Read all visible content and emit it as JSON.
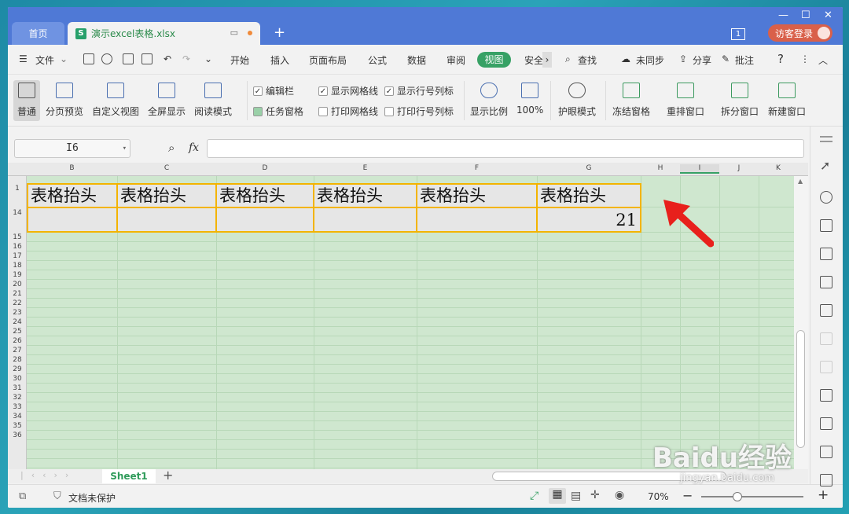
{
  "tabs": {
    "home": "首页",
    "doc": "演示excel表格.xlsx"
  },
  "window": {
    "badge": "1",
    "login": "访客登录"
  },
  "menu": {
    "file": "文件",
    "items": [
      "开始",
      "插入",
      "页面布局",
      "公式",
      "数据",
      "审阅",
      "视图",
      "安全"
    ],
    "find": "查找",
    "sync": "未同步",
    "share": "分享",
    "comment": "批注",
    "help": "?"
  },
  "ribbon": {
    "normal": "普通",
    "pagebreak": "分页预览",
    "customview": "自定义视图",
    "fullscreen": "全屏显示",
    "reading": "阅读模式",
    "editbar": "编辑栏",
    "taskpane": "任务窗格",
    "showgrid": "显示网格线",
    "printgrid": "打印网格线",
    "showhead": "显示行号列标",
    "printhead": "打印行号列标",
    "zoom": "显示比例",
    "zoom100": "100%",
    "eyecare": "护眼模式",
    "freeze": "冻结窗格",
    "arrange": "重排窗口",
    "split": "拆分窗口",
    "newwin": "新建窗口"
  },
  "formula": {
    "name_box": "I6",
    "fx": "fx",
    "value": ""
  },
  "columns": [
    "B",
    "C",
    "D",
    "E",
    "F",
    "G",
    "H",
    "I",
    "J",
    "K"
  ],
  "rows": [
    "1",
    "14",
    "15",
    "16",
    "17",
    "18",
    "19",
    "20",
    "21",
    "22",
    "23",
    "24",
    "25",
    "26",
    "27",
    "28",
    "29",
    "30",
    "31",
    "32",
    "33",
    "34",
    "35",
    "36"
  ],
  "cells": {
    "header": [
      "表格抬头",
      "表格抬头",
      "表格抬头",
      "表格抬头",
      "表格抬头",
      "表格抬头"
    ],
    "g14": "21"
  },
  "sheet": {
    "name": "Sheet1"
  },
  "status": {
    "protect": "文档未保护",
    "zoom": "70%"
  },
  "watermark": {
    "brand": "Baidu经验",
    "url": "jingyan.baidu.com"
  },
  "colors": {
    "title": "#4f79d6",
    "accent": "#37a165",
    "cellBorder": "#f3b400",
    "gridBg": "#cfe7cf",
    "arrow": "#e8201c"
  }
}
